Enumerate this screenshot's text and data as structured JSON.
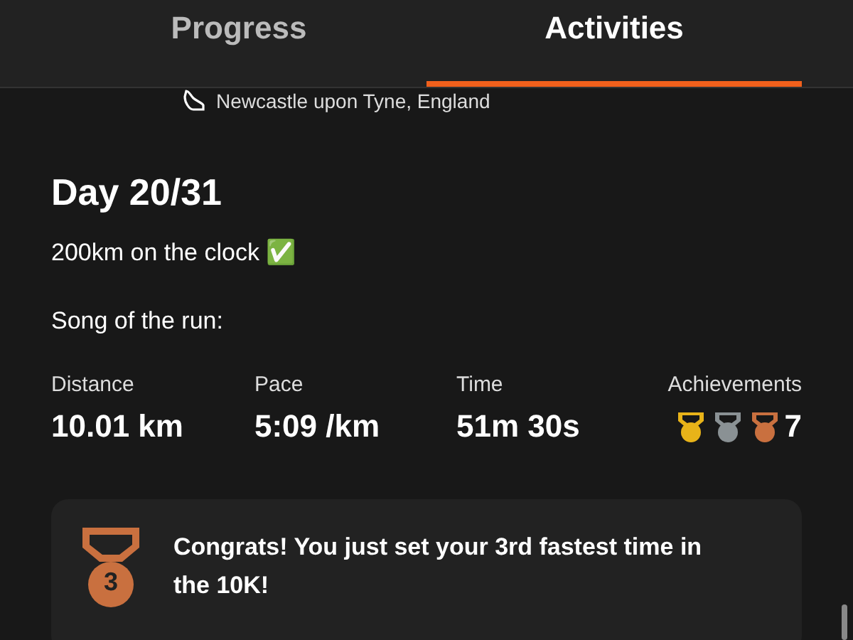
{
  "tabs": [
    {
      "label": "Progress",
      "selected": false
    },
    {
      "label": "Activities",
      "selected": true
    }
  ],
  "location": "Newcastle upon Tyne, England",
  "title": "Day 20/31",
  "description": "200km on the clock ✅",
  "song_label": "Song of the run:",
  "stats": [
    {
      "label": "Distance",
      "value": "10.01 km"
    },
    {
      "label": "Pace",
      "value": "5:09 /km"
    },
    {
      "label": "Time",
      "value": "51m 30s"
    }
  ],
  "achievements": {
    "label": "Achievements",
    "medals": [
      {
        "color": "#e8b319"
      },
      {
        "color": "#8a9194"
      },
      {
        "color": "#c9703f"
      }
    ],
    "count": "7"
  },
  "congrats": {
    "medal_number": "3",
    "text": "Congrats! You just set your 3rd fastest time in the 10K!"
  }
}
